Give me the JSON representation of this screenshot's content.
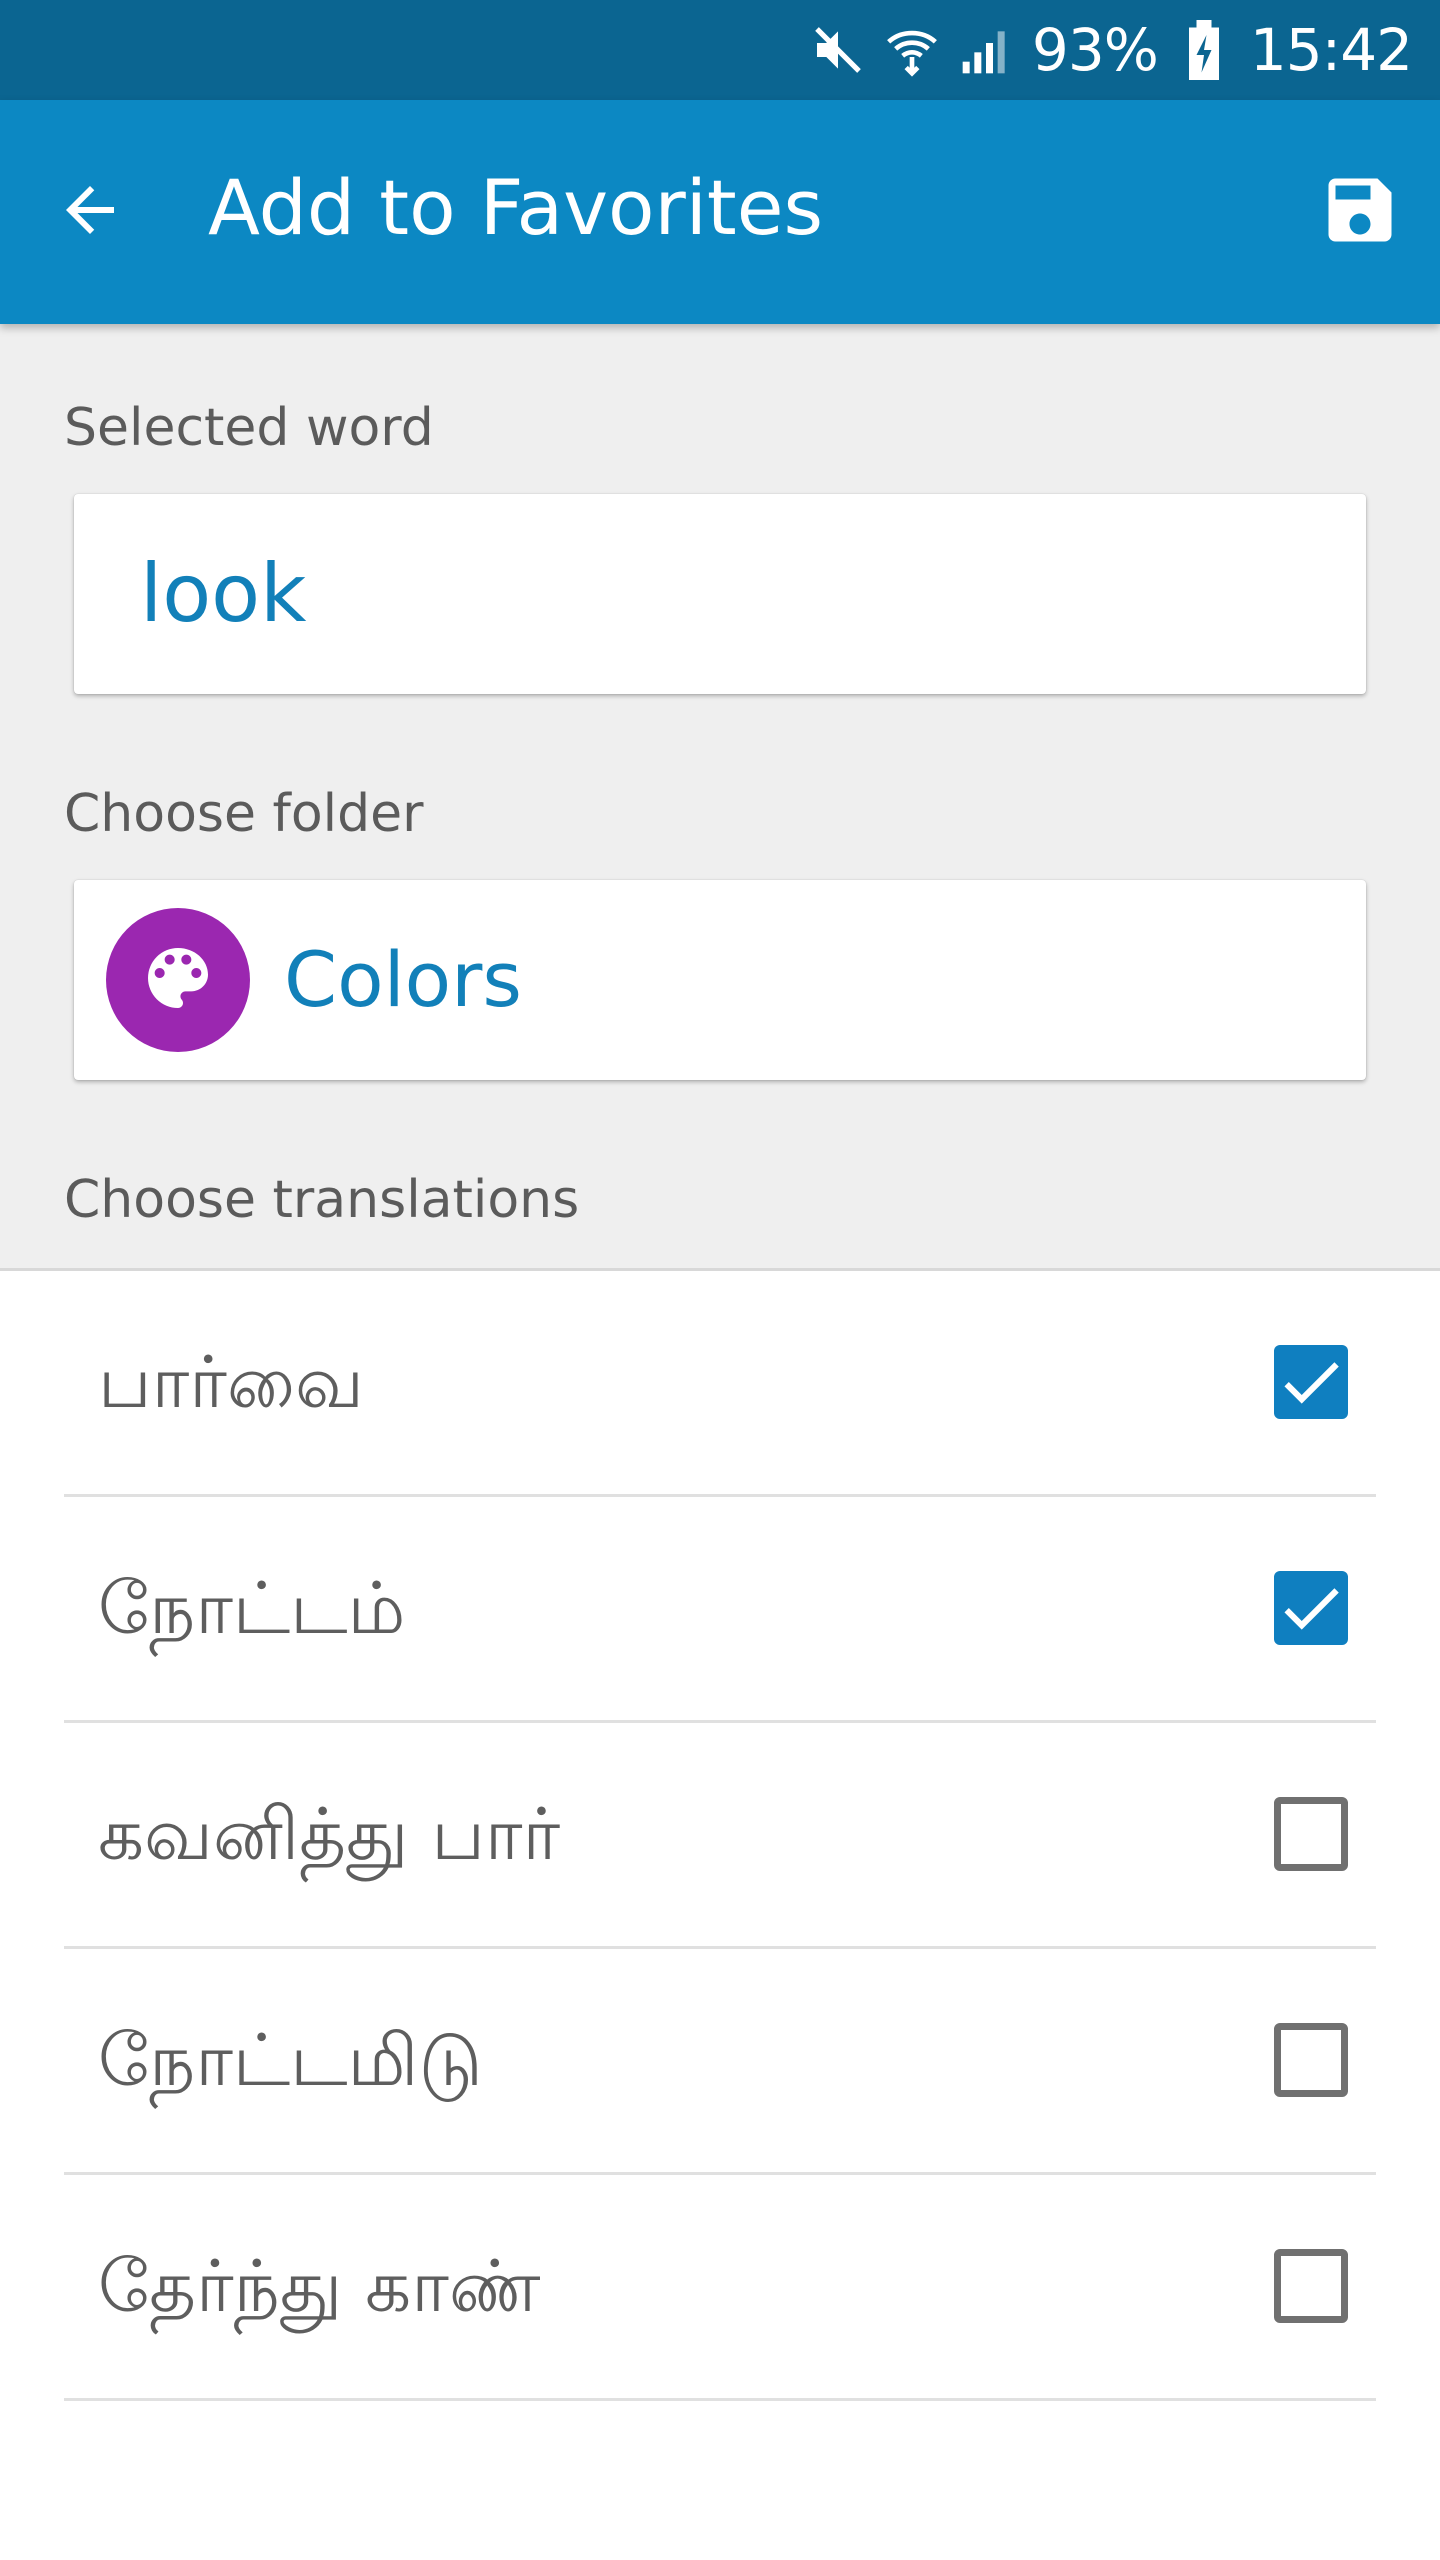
{
  "status_bar": {
    "battery_percent": "93%",
    "time": "15:42",
    "icons": [
      "mute-icon",
      "wifi-icon",
      "signal-icon",
      "battery-charging-icon"
    ]
  },
  "app_bar": {
    "title": "Add to Favorites",
    "back_icon": "arrow-back-icon",
    "save_icon": "save-icon",
    "background": "#0c88c3"
  },
  "selected_word": {
    "label": "Selected word",
    "value": "look"
  },
  "folder": {
    "label": "Choose folder",
    "name": "Colors",
    "icon": "palette-icon",
    "icon_color": "#9b27b0"
  },
  "translations": {
    "label": "Choose translations",
    "items": [
      {
        "text": "பார்வை",
        "checked": true
      },
      {
        "text": "நோட்டம்",
        "checked": true
      },
      {
        "text": "கவனித்து பார்",
        "checked": false
      },
      {
        "text": "நோட்டமிடு",
        "checked": false
      },
      {
        "text": "தேர்ந்து காண்",
        "checked": false
      }
    ]
  },
  "colors": {
    "accent": "#1280b9",
    "status_bar": "#0b6591",
    "checkbox_checked": "#0f7fc0"
  }
}
